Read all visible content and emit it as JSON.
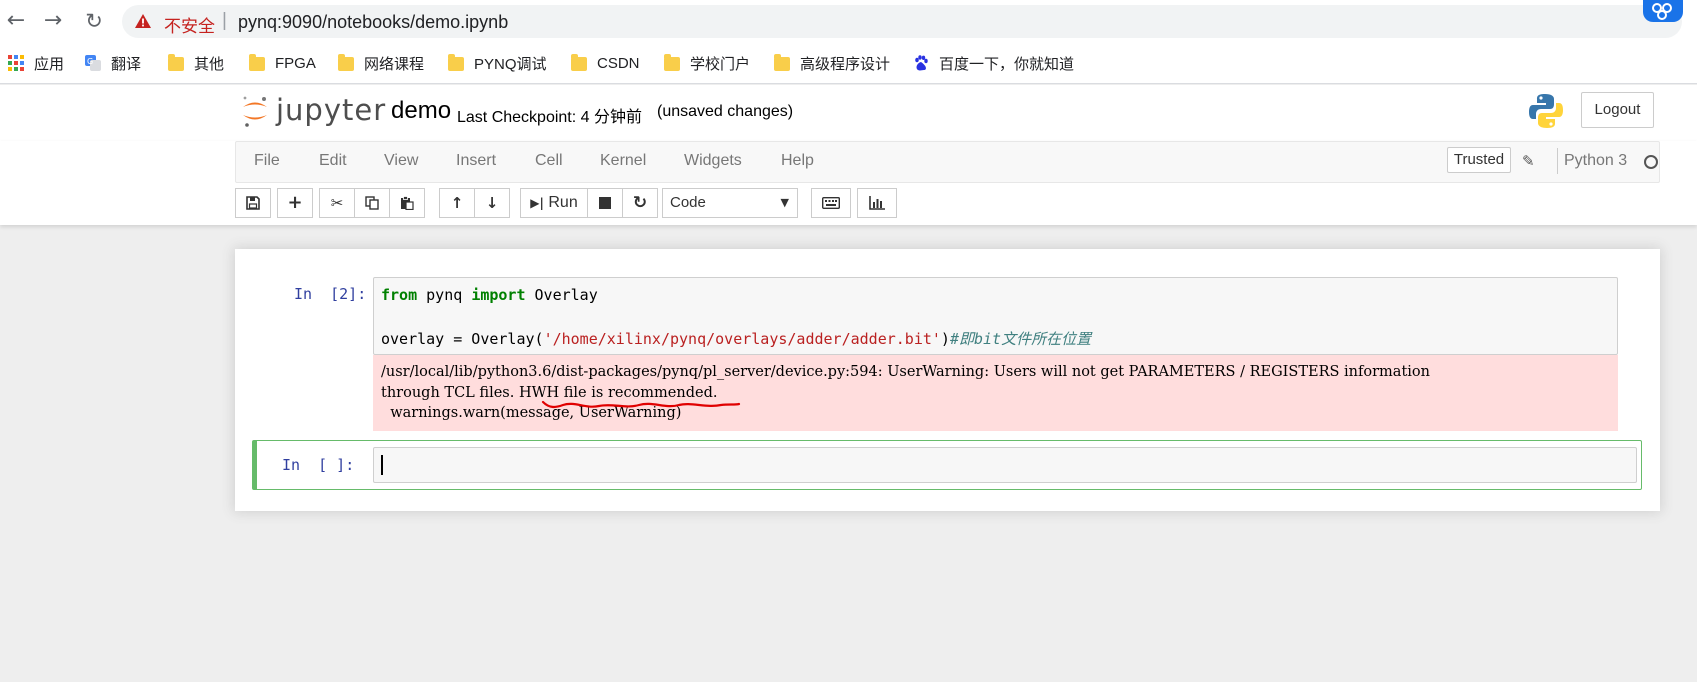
{
  "browser": {
    "insecure_label": "不安全",
    "url": "pynq:9090/notebooks/demo.ipynb"
  },
  "bookmarks": [
    {
      "label": "应用",
      "icon": "apps-grid-icon"
    },
    {
      "label": "翻译",
      "icon": "translate-icon"
    },
    {
      "label": "其他",
      "icon": "folder-icon"
    },
    {
      "label": "FPGA",
      "icon": "folder-icon"
    },
    {
      "label": "网络课程",
      "icon": "folder-icon"
    },
    {
      "label": "PYNQ调试",
      "icon": "folder-icon"
    },
    {
      "label": "CSDN",
      "icon": "folder-icon"
    },
    {
      "label": "学校门户",
      "icon": "folder-icon"
    },
    {
      "label": "高级程序设计",
      "icon": "folder-icon"
    },
    {
      "label": "百度一下，你就知道",
      "icon": "baidu-paw-icon"
    }
  ],
  "header": {
    "logo_text": "jupyter",
    "notebook_name": "demo",
    "checkpoint": "Last Checkpoint: 4 分钟前",
    "unsaved": "(unsaved changes)",
    "logout_label": "Logout"
  },
  "menu": {
    "items": [
      "File",
      "Edit",
      "View",
      "Insert",
      "Cell",
      "Kernel",
      "Widgets",
      "Help"
    ],
    "trusted_label": "Trusted",
    "kernel_name": "Python 3"
  },
  "toolbar": {
    "run_label": "Run",
    "cell_type": "Code"
  },
  "cells": [
    {
      "prompt": "In  [2]:",
      "code": {
        "line1_kw1": "from",
        "line1_mod": " pynq ",
        "line1_kw2": "import",
        "line1_name": " Overlay",
        "line3_pre": "overlay = Overlay(",
        "line3_str": "'/home/xilinx/pynq/overlays/adder/adder.bit'",
        "line3_post": ")",
        "line3_comment": "#即bit文件所在位置"
      },
      "stderr": [
        "/usr/local/lib/python3.6/dist-packages/pynq/pl_server/device.py:594: UserWarning: Users will not get PARAMETERS / REGISTERS information",
        "through TCL files. HWH file is recommended.",
        "  warnings.warn(message, UserWarning)"
      ]
    },
    {
      "prompt": "In  [ ]:",
      "code": ""
    }
  ],
  "colors": {
    "jupyter_orange": "#f37726",
    "stderr_bg": "#ffdddd",
    "selected_border": "#66bb6a",
    "prompt_blue": "#303f9f",
    "annotation_red": "#e00000"
  }
}
